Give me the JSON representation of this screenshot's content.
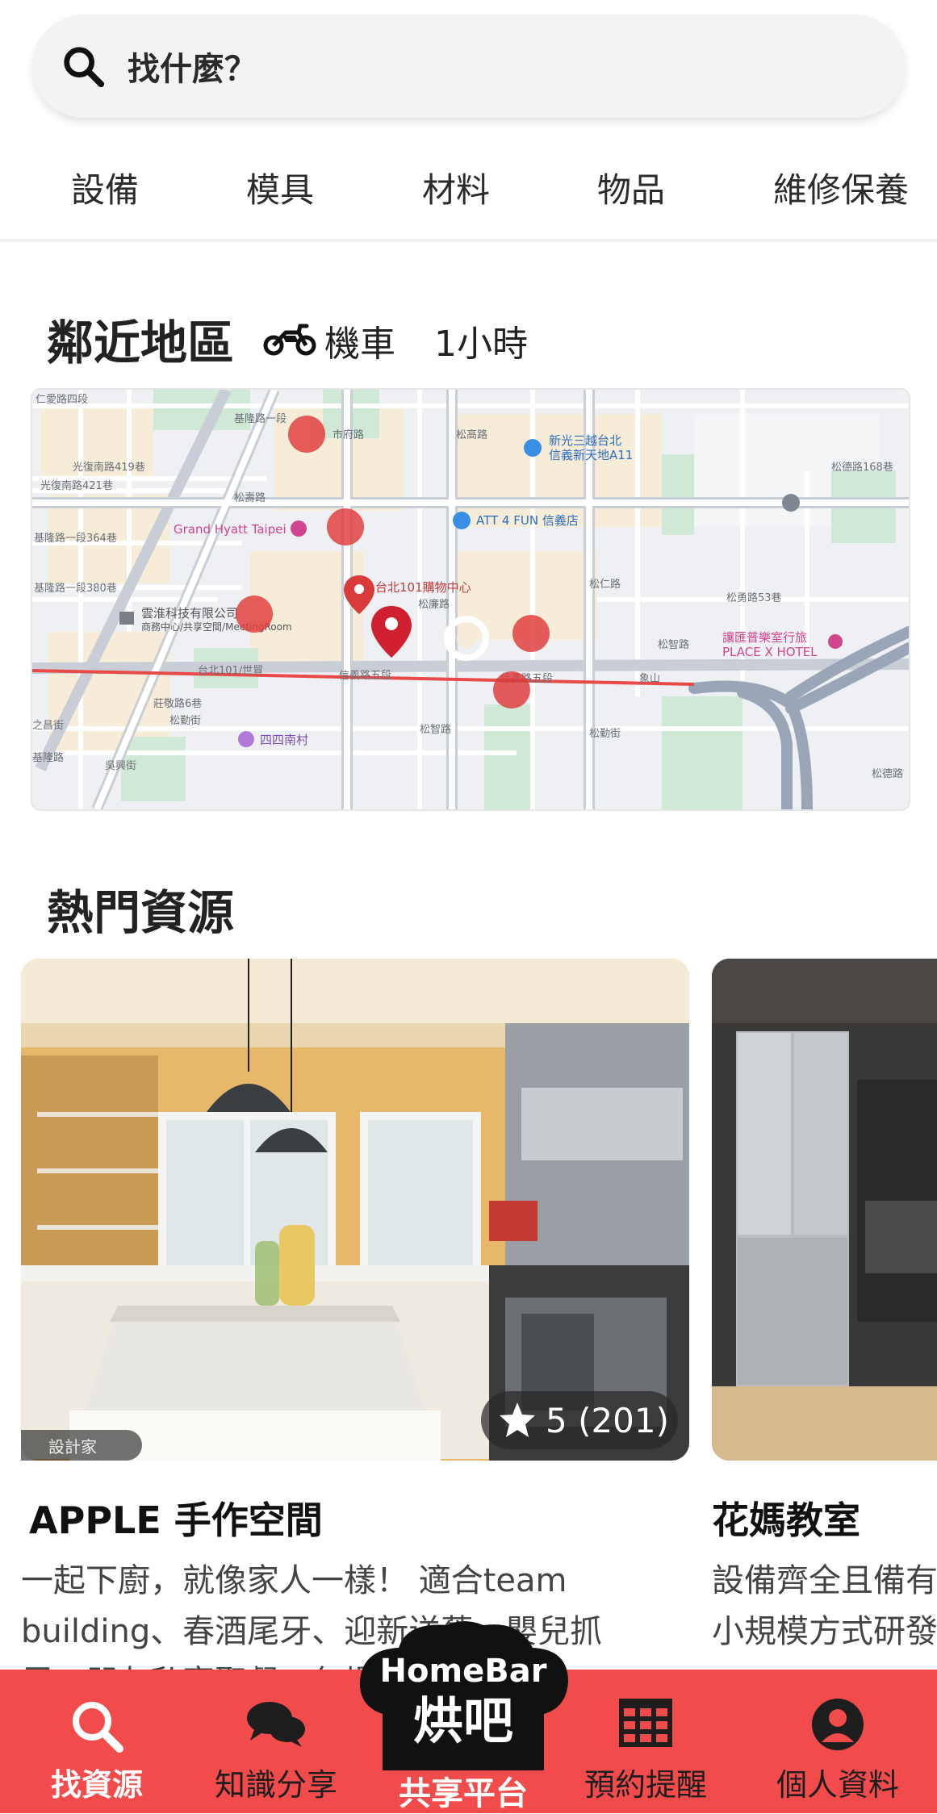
{
  "search": {
    "placeholder": "找什麼？"
  },
  "categories": [
    "設備",
    "模具",
    "材料",
    "物品",
    "維修保養"
  ],
  "nearby": {
    "title": "鄰近地區",
    "transport": "機車",
    "duration": "1小時",
    "map": {
      "labels": {
        "road1": "仁愛路四段",
        "road2": "光復南路419巷",
        "road3": "光復南路421巷",
        "road4": "基隆路一段364巷",
        "road5": "基隆路一段380巷",
        "road6": "松壽路",
        "road7": "台北101/世貿",
        "road8": "信義路五段",
        "road9": "信義路五段",
        "road10": "莊敬路6巷",
        "road11": "松勤街",
        "road12": "松德路168巷",
        "road13": "松勇路53巷",
        "road14": "松勤街",
        "road15": "象山",
        "road16": "基隆路",
        "road17": "松智路",
        "road18": "松仁路",
        "road19": "市府路",
        "road20": "松高路",
        "road21": "松廉路",
        "road22": "吳興街",
        "road23": "松智路",
        "road24": "之昌街",
        "road25": "基隆路一段",
        "road26": "松德路",
        "poi_grand_hyatt": "Grand Hyatt Taipei",
        "poi_att": "ATT 4 FUN 信義店",
        "poi_shinkong_1": "新光三越台北",
        "poi_shinkong_2": "信義新天地A11",
        "poi_101": "台北101購物中心",
        "poi_yunzhe_1": "雲淮科技有限公司",
        "poi_yunzhe_2": "商務中心/共享空間/MeetingRoom",
        "poi_hotel_1": "讓匯普樂室行旅",
        "poi_hotel_2": "PLACE X HOTEL",
        "poi_village": "四四南村"
      }
    }
  },
  "popular": {
    "title": "熱門資源",
    "cards": [
      {
        "title": "APPLE 手作空間",
        "desc_line1": "一起下廚，就像家人一樣！ 適合team",
        "desc_line2": "building、春酒尾牙、迎新送舊、嬰兒抓",
        "desc_line3": "周、朋友私宴聚餐、包場、活動、派對",
        "rating": "5 (201)",
        "watermark": "設計家"
      },
      {
        "title": "花媽教室",
        "desc_line1": "設備齊全且備有",
        "desc_line2": "小規模方式研發"
      }
    ]
  },
  "bottom_nav": {
    "items": [
      {
        "label": "找資源",
        "icon": "search-icon"
      },
      {
        "label": "知識分享",
        "icon": "chat-bubbles-icon"
      },
      {
        "label": "共享平台",
        "icon": "homebar-logo"
      },
      {
        "label": "預約提醒",
        "icon": "calendar-grid-icon"
      },
      {
        "label": "個人資料",
        "icon": "user-icon"
      }
    ],
    "logo_line1": "HomeBar",
    "logo_line2": "烘吧"
  },
  "colors": {
    "accent": "#f24b4b",
    "map_marker": "#e03b3b"
  }
}
